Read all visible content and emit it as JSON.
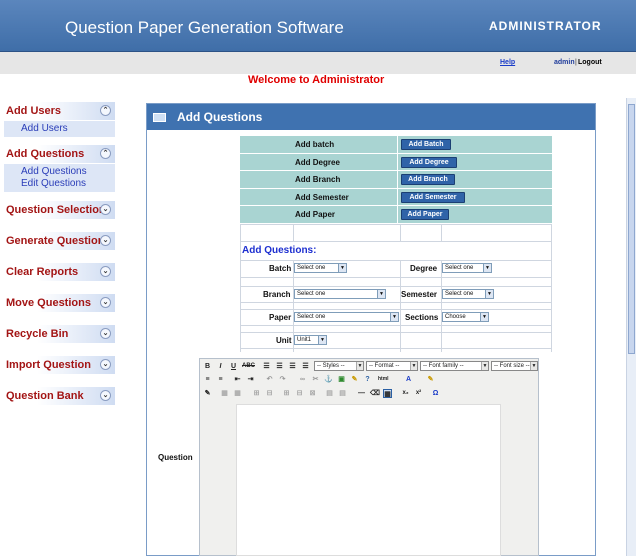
{
  "header": {
    "title": "Question Paper Generation Software",
    "role": "ADMINISTRATOR"
  },
  "topbar": {
    "help": "Help",
    "user": "admin",
    "separator": "|",
    "logout": "Logout"
  },
  "welcome": "Welcome to Administrator",
  "sidebar": {
    "sections": [
      {
        "label": "Add Users",
        "items": [
          "Add Users"
        ]
      },
      {
        "label": "Add Questions",
        "items": [
          "Add Questions",
          "Edit Questions"
        ]
      },
      {
        "label": "Question Selection",
        "items": []
      },
      {
        "label": "Generate Question",
        "items": []
      },
      {
        "label": "Clear Reports",
        "items": []
      },
      {
        "label": "Move Questions",
        "items": []
      },
      {
        "label": "Recycle Bin",
        "items": []
      },
      {
        "label": "Import Question",
        "items": []
      },
      {
        "label": "Question Bank",
        "items": []
      }
    ]
  },
  "panel": {
    "title": "Add Questions",
    "rows": [
      {
        "label": "Add batch",
        "button": "Add Batch"
      },
      {
        "label": "Add Degree",
        "button": "Add Degree"
      },
      {
        "label": "Add Branch",
        "button": "Add Branch"
      },
      {
        "label": "Add Semester",
        "button": "Add Semester"
      },
      {
        "label": "Add Paper",
        "button": "Add Paper"
      }
    ],
    "form_title": "Add Questions:",
    "fields": {
      "batch": {
        "label": "Batch",
        "value": "Select one"
      },
      "degree": {
        "label": "Degree",
        "value": "Select one"
      },
      "branch": {
        "label": "Branch",
        "value": "Select one"
      },
      "semester": {
        "label": "Semester",
        "value": "Select one"
      },
      "paper": {
        "label": "Paper",
        "value": "Select one"
      },
      "sections": {
        "label": "Sections",
        "value": "Choose"
      },
      "unit": {
        "label": "Unit",
        "value": "Unit1"
      }
    },
    "question_label": "Question",
    "editor": {
      "styles": "-- Styles --",
      "format": "-- Format --",
      "font_family": "-- Font family --",
      "font_size": "-- Font size --"
    }
  },
  "colors": {
    "header": "#3f6ea8",
    "welcome": "#e00000",
    "button": "#2f63a8",
    "grid": "#a9d4d2"
  }
}
